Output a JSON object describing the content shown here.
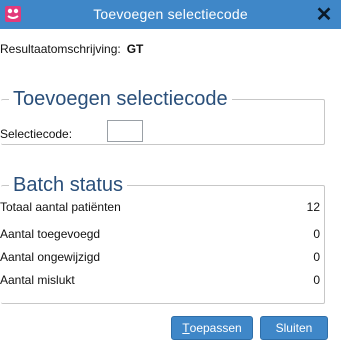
{
  "window": {
    "title": "Toevoegen selectiecode",
    "close_symbol": "✕",
    "accent": "#3f87c8"
  },
  "result": {
    "label": "Resultaatomschrijving:",
    "value": "GT"
  },
  "selectiecode": {
    "legend": "Toevoegen selectiecode",
    "label": "Selectiecode:",
    "value": ""
  },
  "batch_status": {
    "legend": "Batch status",
    "rows": [
      {
        "label": "Totaal aantal patiënten",
        "value": "12"
      },
      {
        "label": "Aantal toegevoegd",
        "value": "0"
      },
      {
        "label": "Aantal ongewijzigd",
        "value": "0"
      },
      {
        "label": "Aantal mislukt",
        "value": "0"
      }
    ]
  },
  "buttons": {
    "apply_mnemonic": "T",
    "apply_rest": "oepassen",
    "close_label": "Sluiten"
  },
  "icons": {
    "app": "app-logo-icon",
    "close": "close-icon"
  }
}
